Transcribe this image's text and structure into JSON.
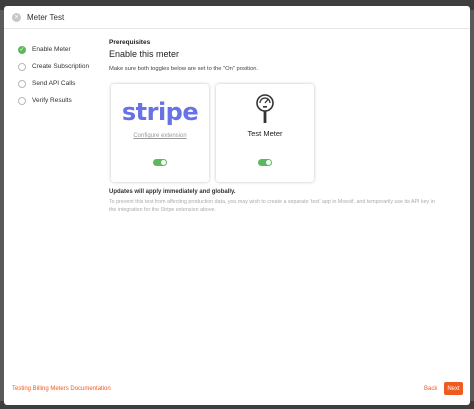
{
  "modal": {
    "title": "Meter Test",
    "close_glyph": "×"
  },
  "steps": [
    {
      "label": "Enable Meter",
      "state": "done"
    },
    {
      "label": "Create Subscription",
      "state": "pending"
    },
    {
      "label": "Send API Calls",
      "state": "pending"
    },
    {
      "label": "Verify Results",
      "state": "pending"
    }
  ],
  "content": {
    "kicker": "Prerequisites",
    "heading": "Enable this meter",
    "instruction": "Make sure both toggles below are set to the \"On\" position."
  },
  "cards": {
    "stripe": {
      "logo_text": "stripe",
      "link": "Configure extension",
      "toggle_on": true
    },
    "meter": {
      "label": "Test Meter",
      "icon": "parking-meter-icon",
      "toggle_on": true
    }
  },
  "notes": {
    "bold": "Updates will apply immediately and globally.",
    "muted": "To prevent this test from affecting production data, you may wish to create a separate 'test' app in Moesif, and temporarily use its API key in the integration for the Stripe extension above."
  },
  "footer": {
    "doc_link": "Testing Billing Meters Documentation",
    "back": "Back",
    "next": "Next"
  },
  "colors": {
    "accent": "#f05a1f",
    "success": "#5cb85c",
    "stripe": "#6772e5"
  }
}
